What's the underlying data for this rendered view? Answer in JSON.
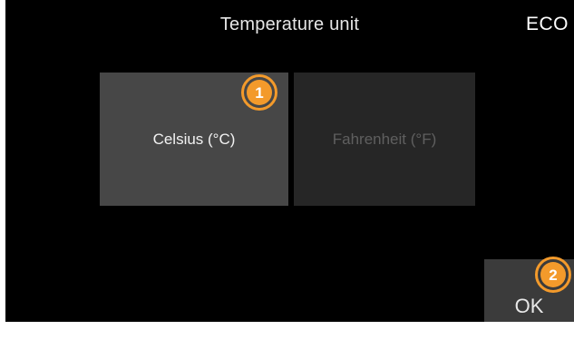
{
  "header": {
    "title": "Temperature unit",
    "mode_badge": "ECO"
  },
  "options": [
    {
      "label": "Celsius (°C)",
      "state": "selected"
    },
    {
      "label": "Fahrenheit (°F)",
      "state": "unselected"
    }
  ],
  "confirm": {
    "label": "OK"
  },
  "callouts": [
    {
      "number": "1"
    },
    {
      "number": "2"
    }
  ],
  "colors": {
    "background": "#000000",
    "selected_option": "#474747",
    "unselected_option": "#262626",
    "ok_button": "#3b3b3b",
    "callout_accent": "#f39a2b"
  }
}
